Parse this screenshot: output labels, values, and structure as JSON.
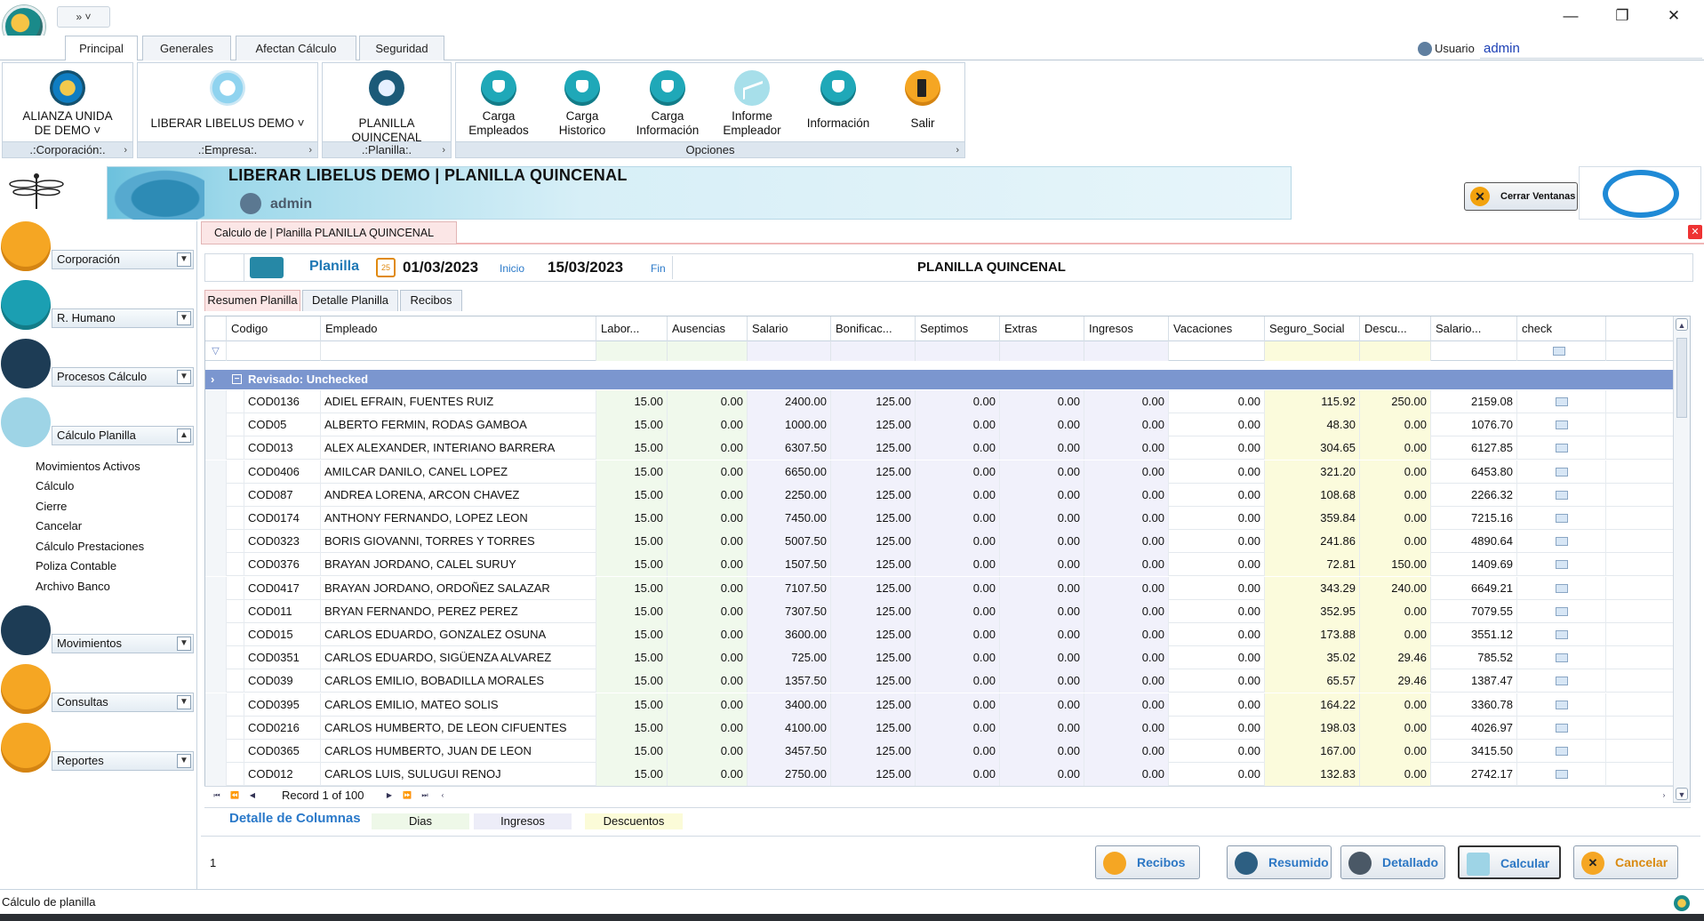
{
  "window": {
    "quick_access": "» ˅",
    "minimize": "—",
    "restore": "❐",
    "close": "✕"
  },
  "ribbon_tabs": [
    "Principal",
    "Generales",
    "Afectan Cálculo",
    "Seguridad"
  ],
  "user": {
    "label": "Usuario",
    "value": "admin"
  },
  "ribbon": {
    "corporation": {
      "label": "ALIANZA UNIDA DE DEMO ˅",
      "caption": ".:Corporación:."
    },
    "company": {
      "label": "LIBERAR LIBELUS DEMO ˅",
      "caption": ".:Empresa:."
    },
    "payroll": {
      "label": "PLANILLA QUINCENAL",
      "caption": ".:Planilla:."
    },
    "options_caption": "Opciones",
    "options": [
      {
        "label": "Carga Empleados",
        "icon": "upload-users-icon"
      },
      {
        "label": "Carga Historico",
        "icon": "upload-history-icon"
      },
      {
        "label": "Carga Información",
        "icon": "upload-info-icon"
      },
      {
        "label": "Informe Empleador",
        "icon": "report-chart-icon"
      },
      {
        "label": "Información",
        "icon": "info-bulb-icon"
      },
      {
        "label": "Salir",
        "icon": "exit-door-icon"
      }
    ]
  },
  "banner": {
    "title": "LIBERAR LIBELUS DEMO | PLANILLA QUINCENAL",
    "user": "admin",
    "close_windows": "Cerrar Ventanas"
  },
  "sidebar": {
    "sections": [
      {
        "label": "Corporación",
        "icon": "store-icon"
      },
      {
        "label": "R. Humano",
        "icon": "person-icon"
      },
      {
        "label": "Procesos  Cálculo",
        "icon": "hand-pointer-icon"
      },
      {
        "label": "Cálculo Planilla",
        "icon": "payroll-card-icon"
      },
      {
        "label": "Movimientos",
        "icon": "cursor-click-icon"
      },
      {
        "label": "Consultas",
        "icon": "magnifier-icon"
      },
      {
        "label": "Reportes",
        "icon": "pencil-note-icon"
      }
    ],
    "calc_items": [
      "Movimientos Activos",
      "Cálculo",
      "Cierre",
      "Cancelar",
      "Cálculo Prestaciones",
      "Poliza Contable",
      "Archivo Banco"
    ]
  },
  "document_tab": "Calculo de  | Planilla PLANILLA QUINCENAL",
  "info_bar": {
    "planilla_label": "Planilla",
    "calendar_day": "25",
    "start_date": "01/03/2023",
    "start_label": "Inicio",
    "end_date": "15/03/2023",
    "end_label": "Fin",
    "payroll_name": "PLANILLA QUINCENAL"
  },
  "sub_tabs": [
    "Resumen Planilla",
    "Detalle Planilla",
    "Recibos"
  ],
  "grid": {
    "columns": [
      "Codigo",
      "Empleado",
      "Labor...",
      "Ausencias",
      "Salario",
      "Bonificac...",
      "Septimos",
      "Extras",
      "Ingresos",
      "Vacaciones",
      "Seguro_Social",
      "Descu...",
      "Salario...",
      "check"
    ],
    "group_label": "Revisado: Unchecked",
    "rows": [
      [
        "COD0136",
        "ADIEL EFRAIN, FUENTES RUIZ",
        "15.00",
        "0.00",
        "2400.00",
        "125.00",
        "0.00",
        "0.00",
        "0.00",
        "0.00",
        "115.92",
        "250.00",
        "2159.08"
      ],
      [
        "COD05",
        "ALBERTO FERMIN, RODAS GAMBOA",
        "15.00",
        "0.00",
        "1000.00",
        "125.00",
        "0.00",
        "0.00",
        "0.00",
        "0.00",
        "48.30",
        "0.00",
        "1076.70"
      ],
      [
        "COD013",
        "ALEX ALEXANDER, INTERIANO BARRERA",
        "15.00",
        "0.00",
        "6307.50",
        "125.00",
        "0.00",
        "0.00",
        "0.00",
        "0.00",
        "304.65",
        "0.00",
        "6127.85"
      ],
      [
        "COD0406",
        "AMILCAR DANILO, CANEL LOPEZ",
        "15.00",
        "0.00",
        "6650.00",
        "125.00",
        "0.00",
        "0.00",
        "0.00",
        "0.00",
        "321.20",
        "0.00",
        "6453.80"
      ],
      [
        "COD087",
        "ANDREA LORENA, ARCON CHAVEZ",
        "15.00",
        "0.00",
        "2250.00",
        "125.00",
        "0.00",
        "0.00",
        "0.00",
        "0.00",
        "108.68",
        "0.00",
        "2266.32"
      ],
      [
        "COD0174",
        "ANTHONY FERNANDO, LOPEZ LEON",
        "15.00",
        "0.00",
        "7450.00",
        "125.00",
        "0.00",
        "0.00",
        "0.00",
        "0.00",
        "359.84",
        "0.00",
        "7215.16"
      ],
      [
        "COD0323",
        "BORIS GIOVANNI, TORRES Y TORRES",
        "15.00",
        "0.00",
        "5007.50",
        "125.00",
        "0.00",
        "0.00",
        "0.00",
        "0.00",
        "241.86",
        "0.00",
        "4890.64"
      ],
      [
        "COD0376",
        "BRAYAN JORDANO, CALEL SURUY",
        "15.00",
        "0.00",
        "1507.50",
        "125.00",
        "0.00",
        "0.00",
        "0.00",
        "0.00",
        "72.81",
        "150.00",
        "1409.69"
      ],
      [
        "COD0417",
        "BRAYAN JORDANO, ORDOÑEZ SALAZAR",
        "15.00",
        "0.00",
        "7107.50",
        "125.00",
        "0.00",
        "0.00",
        "0.00",
        "0.00",
        "343.29",
        "240.00",
        "6649.21"
      ],
      [
        "COD011",
        "BRYAN FERNANDO, PEREZ PEREZ",
        "15.00",
        "0.00",
        "7307.50",
        "125.00",
        "0.00",
        "0.00",
        "0.00",
        "0.00",
        "352.95",
        "0.00",
        "7079.55"
      ],
      [
        "COD015",
        "CARLOS EDUARDO, GONZALEZ OSUNA",
        "15.00",
        "0.00",
        "3600.00",
        "125.00",
        "0.00",
        "0.00",
        "0.00",
        "0.00",
        "173.88",
        "0.00",
        "3551.12"
      ],
      [
        "COD0351",
        "CARLOS EDUARDO, SIGÜENZA ALVAREZ",
        "15.00",
        "0.00",
        "725.00",
        "125.00",
        "0.00",
        "0.00",
        "0.00",
        "0.00",
        "35.02",
        "29.46",
        "785.52"
      ],
      [
        "COD039",
        "CARLOS EMILIO, BOBADILLA MORALES",
        "15.00",
        "0.00",
        "1357.50",
        "125.00",
        "0.00",
        "0.00",
        "0.00",
        "0.00",
        "65.57",
        "29.46",
        "1387.47"
      ],
      [
        "COD0395",
        "CARLOS EMILIO, MATEO SOLIS",
        "15.00",
        "0.00",
        "3400.00",
        "125.00",
        "0.00",
        "0.00",
        "0.00",
        "0.00",
        "164.22",
        "0.00",
        "3360.78"
      ],
      [
        "COD0216",
        "CARLOS HUMBERTO, DE LEON CIFUENTES",
        "15.00",
        "0.00",
        "4100.00",
        "125.00",
        "0.00",
        "0.00",
        "0.00",
        "0.00",
        "198.03",
        "0.00",
        "4026.97"
      ],
      [
        "COD0365",
        "CARLOS HUMBERTO, JUAN DE LEON",
        "15.00",
        "0.00",
        "3457.50",
        "125.00",
        "0.00",
        "0.00",
        "0.00",
        "0.00",
        "167.00",
        "0.00",
        "3415.50"
      ],
      [
        "COD012",
        "CARLOS LUIS, SULUGUI RENOJ",
        "15.00",
        "0.00",
        "2750.00",
        "125.00",
        "0.00",
        "0.00",
        "0.00",
        "0.00",
        "132.83",
        "0.00",
        "2742.17"
      ]
    ]
  },
  "navigator": {
    "record_text": "Record 1 of 100"
  },
  "legend": {
    "title": "Detalle de Columnas",
    "items": [
      {
        "label": "Dias",
        "color": "#eef8e8"
      },
      {
        "label": "Ingresos",
        "color": "#ededf8"
      },
      {
        "label": "Descuentos",
        "color": "#fbfbd8"
      }
    ]
  },
  "bottom": {
    "count": "1",
    "buttons": [
      "Recibos",
      "Resumido",
      "Detallado",
      "Calcular",
      "Cancelar"
    ]
  },
  "status": {
    "text": "Cálculo de planilla"
  },
  "colors": {
    "accent": "#2a79c9",
    "group_row": "#7b96cf",
    "orange": "#f5a623",
    "teal": "#1b9fb2"
  }
}
